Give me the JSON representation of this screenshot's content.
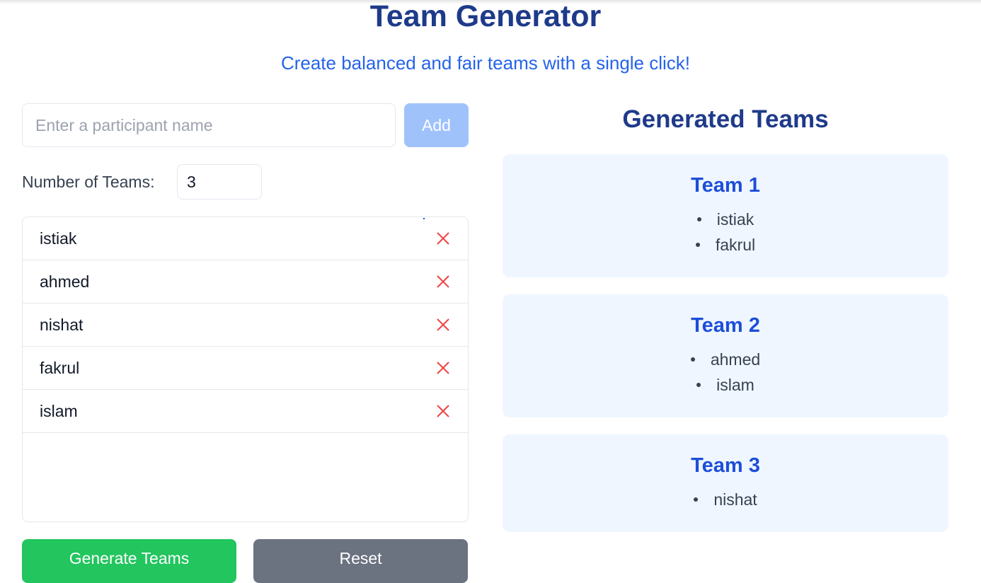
{
  "header": {
    "title": "Team Generator",
    "subtitle": "Create balanced and fair teams with a single click!"
  },
  "form": {
    "name_placeholder": "Enter a participant name",
    "name_value": "",
    "add_label": "Add",
    "teams_label": "Number of Teams:",
    "teams_value": "3"
  },
  "participants": [
    "istiak",
    "ahmed",
    "nishat",
    "fakrul",
    "islam"
  ],
  "actions": {
    "generate_label": "Generate Teams",
    "reset_label": "Reset"
  },
  "results": {
    "title": "Generated Teams",
    "teams": [
      {
        "name": "Team 1",
        "members": [
          "istiak",
          "fakrul"
        ]
      },
      {
        "name": "Team 2",
        "members": [
          "ahmed",
          "islam"
        ]
      },
      {
        "name": "Team 3",
        "members": [
          "nishat"
        ]
      }
    ]
  },
  "colors": {
    "title": "#1e3a8a",
    "subtitle": "#2563eb",
    "add_button": "#9fc2fb",
    "remove_icon": "#ef4444",
    "generate_button": "#22c55e",
    "reset_button": "#6b7280",
    "team_card": "#eff6ff",
    "team_name": "#1d4ed8"
  },
  "icons": {
    "remove": "close-icon"
  }
}
